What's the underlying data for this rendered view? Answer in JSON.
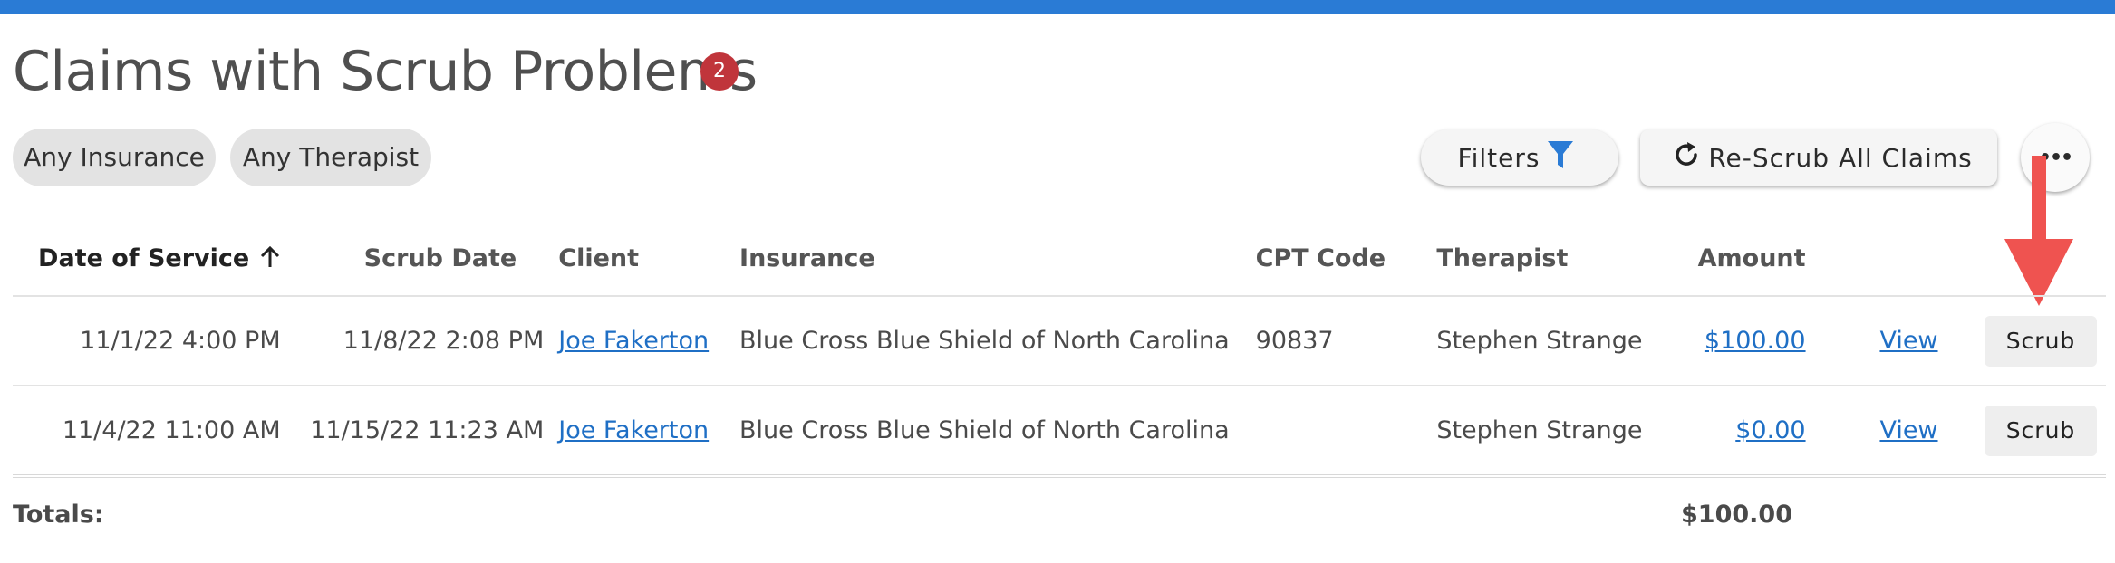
{
  "title": "Claims with Scrub Problems",
  "badge_count": "2",
  "accent_color": "#2a7bd5",
  "chips": {
    "insurance": "Any Insurance",
    "therapist": "Any Therapist"
  },
  "buttons": {
    "filters": "Filters",
    "rescrub": "Re-Scrub All Claims",
    "more": "•••",
    "scrub": "Scrub",
    "view": "View"
  },
  "icons": {
    "filters": "funnel-icon",
    "rescrub": "refresh-icon",
    "sort": "arrow-up-icon",
    "more": "ellipsis-icon"
  },
  "columns": {
    "date_of_service": "Date of Service",
    "scrub_date": "Scrub Date",
    "client": "Client",
    "insurance": "Insurance",
    "cpt_code": "CPT Code",
    "therapist": "Therapist",
    "amount": "Amount"
  },
  "rows": [
    {
      "date_of_service": "11/1/22 4:00 PM",
      "scrub_date": "11/8/22 2:08 PM",
      "client": "Joe Fakerton",
      "insurance": "Blue Cross Blue Shield of North Carolina",
      "cpt_code": "90837",
      "therapist": "Stephen Strange",
      "amount": "$100.00",
      "view": "View",
      "scrub": "Scrub"
    },
    {
      "date_of_service": "11/4/22 11:00 AM",
      "scrub_date": "11/15/22 11:23 AM",
      "client": "Joe Fakerton",
      "insurance": "Blue Cross Blue Shield of North Carolina",
      "cpt_code": "",
      "therapist": "Stephen Strange",
      "amount": "$0.00",
      "view": "View",
      "scrub": "Scrub"
    }
  ],
  "totals": {
    "label": "Totals:",
    "amount": "$100.00"
  }
}
